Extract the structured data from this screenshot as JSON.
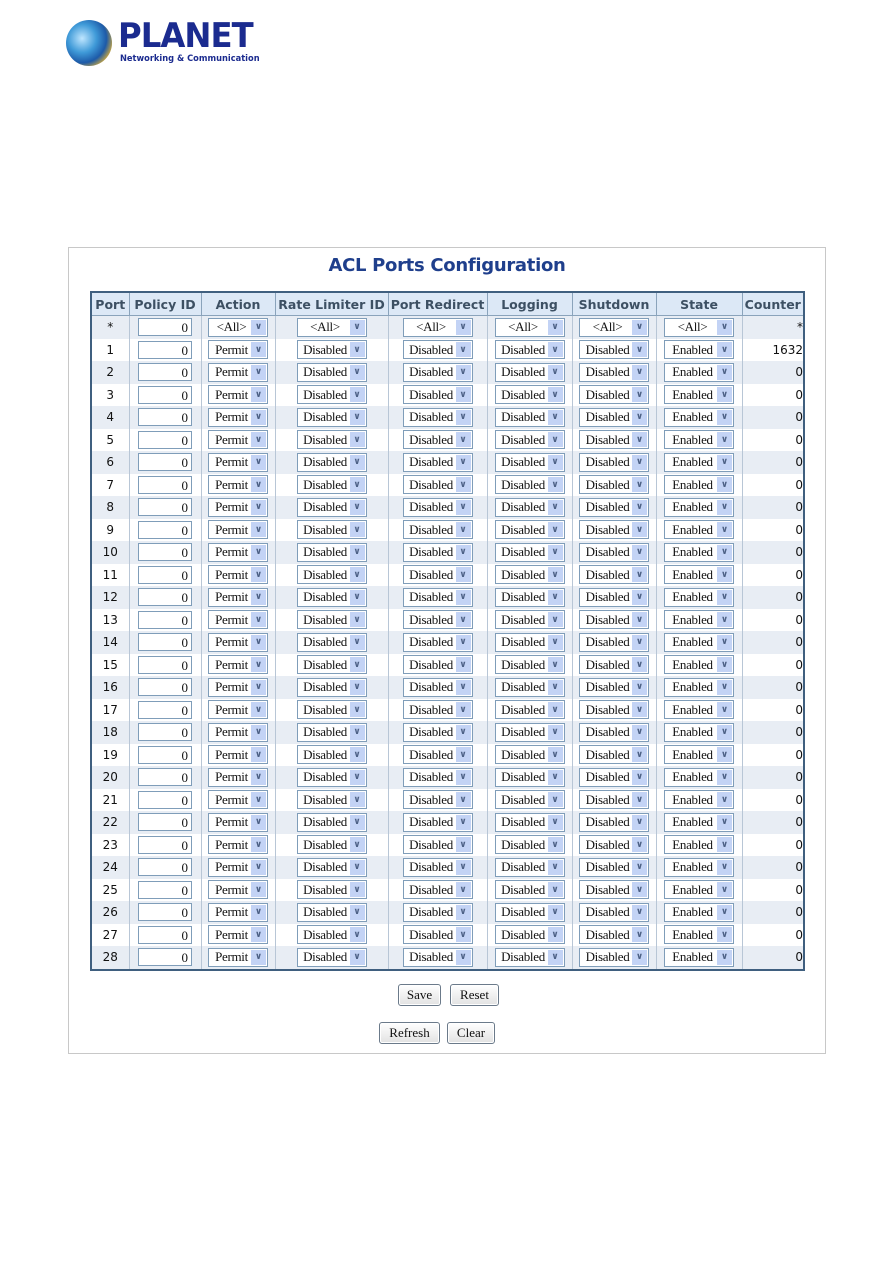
{
  "brand": {
    "name": "PLANET",
    "tagline": "Networking & Communication"
  },
  "page": {
    "title": "ACL Ports Configuration"
  },
  "colors": {
    "title": "#1f3f8c",
    "header_bg": "#dce8f6",
    "table_border": "#3f5f7f",
    "row_alt": "#e8edf4"
  },
  "table": {
    "headers": [
      "Port",
      "Policy ID",
      "Action",
      "Rate Limiter ID",
      "Port Redirect",
      "Logging",
      "Shutdown",
      "State",
      "Counter"
    ],
    "global_row": {
      "port": "*",
      "policy_id": "0",
      "action": "<All>",
      "rate_limiter_id": "<All>",
      "port_redirect": "<All>",
      "logging": "<All>",
      "shutdown": "<All>",
      "state": "<All>",
      "counter": "*"
    },
    "rows": [
      {
        "port": "1",
        "policy_id": "0",
        "action": "Permit",
        "rate_limiter_id": "Disabled",
        "port_redirect": "Disabled",
        "logging": "Disabled",
        "shutdown": "Disabled",
        "state": "Enabled",
        "counter": "1632"
      },
      {
        "port": "2",
        "policy_id": "0",
        "action": "Permit",
        "rate_limiter_id": "Disabled",
        "port_redirect": "Disabled",
        "logging": "Disabled",
        "shutdown": "Disabled",
        "state": "Enabled",
        "counter": "0"
      },
      {
        "port": "3",
        "policy_id": "0",
        "action": "Permit",
        "rate_limiter_id": "Disabled",
        "port_redirect": "Disabled",
        "logging": "Disabled",
        "shutdown": "Disabled",
        "state": "Enabled",
        "counter": "0"
      },
      {
        "port": "4",
        "policy_id": "0",
        "action": "Permit",
        "rate_limiter_id": "Disabled",
        "port_redirect": "Disabled",
        "logging": "Disabled",
        "shutdown": "Disabled",
        "state": "Enabled",
        "counter": "0"
      },
      {
        "port": "5",
        "policy_id": "0",
        "action": "Permit",
        "rate_limiter_id": "Disabled",
        "port_redirect": "Disabled",
        "logging": "Disabled",
        "shutdown": "Disabled",
        "state": "Enabled",
        "counter": "0"
      },
      {
        "port": "6",
        "policy_id": "0",
        "action": "Permit",
        "rate_limiter_id": "Disabled",
        "port_redirect": "Disabled",
        "logging": "Disabled",
        "shutdown": "Disabled",
        "state": "Enabled",
        "counter": "0"
      },
      {
        "port": "7",
        "policy_id": "0",
        "action": "Permit",
        "rate_limiter_id": "Disabled",
        "port_redirect": "Disabled",
        "logging": "Disabled",
        "shutdown": "Disabled",
        "state": "Enabled",
        "counter": "0"
      },
      {
        "port": "8",
        "policy_id": "0",
        "action": "Permit",
        "rate_limiter_id": "Disabled",
        "port_redirect": "Disabled",
        "logging": "Disabled",
        "shutdown": "Disabled",
        "state": "Enabled",
        "counter": "0"
      },
      {
        "port": "9",
        "policy_id": "0",
        "action": "Permit",
        "rate_limiter_id": "Disabled",
        "port_redirect": "Disabled",
        "logging": "Disabled",
        "shutdown": "Disabled",
        "state": "Enabled",
        "counter": "0"
      },
      {
        "port": "10",
        "policy_id": "0",
        "action": "Permit",
        "rate_limiter_id": "Disabled",
        "port_redirect": "Disabled",
        "logging": "Disabled",
        "shutdown": "Disabled",
        "state": "Enabled",
        "counter": "0"
      },
      {
        "port": "11",
        "policy_id": "0",
        "action": "Permit",
        "rate_limiter_id": "Disabled",
        "port_redirect": "Disabled",
        "logging": "Disabled",
        "shutdown": "Disabled",
        "state": "Enabled",
        "counter": "0"
      },
      {
        "port": "12",
        "policy_id": "0",
        "action": "Permit",
        "rate_limiter_id": "Disabled",
        "port_redirect": "Disabled",
        "logging": "Disabled",
        "shutdown": "Disabled",
        "state": "Enabled",
        "counter": "0"
      },
      {
        "port": "13",
        "policy_id": "0",
        "action": "Permit",
        "rate_limiter_id": "Disabled",
        "port_redirect": "Disabled",
        "logging": "Disabled",
        "shutdown": "Disabled",
        "state": "Enabled",
        "counter": "0"
      },
      {
        "port": "14",
        "policy_id": "0",
        "action": "Permit",
        "rate_limiter_id": "Disabled",
        "port_redirect": "Disabled",
        "logging": "Disabled",
        "shutdown": "Disabled",
        "state": "Enabled",
        "counter": "0"
      },
      {
        "port": "15",
        "policy_id": "0",
        "action": "Permit",
        "rate_limiter_id": "Disabled",
        "port_redirect": "Disabled",
        "logging": "Disabled",
        "shutdown": "Disabled",
        "state": "Enabled",
        "counter": "0"
      },
      {
        "port": "16",
        "policy_id": "0",
        "action": "Permit",
        "rate_limiter_id": "Disabled",
        "port_redirect": "Disabled",
        "logging": "Disabled",
        "shutdown": "Disabled",
        "state": "Enabled",
        "counter": "0"
      },
      {
        "port": "17",
        "policy_id": "0",
        "action": "Permit",
        "rate_limiter_id": "Disabled",
        "port_redirect": "Disabled",
        "logging": "Disabled",
        "shutdown": "Disabled",
        "state": "Enabled",
        "counter": "0"
      },
      {
        "port": "18",
        "policy_id": "0",
        "action": "Permit",
        "rate_limiter_id": "Disabled",
        "port_redirect": "Disabled",
        "logging": "Disabled",
        "shutdown": "Disabled",
        "state": "Enabled",
        "counter": "0"
      },
      {
        "port": "19",
        "policy_id": "0",
        "action": "Permit",
        "rate_limiter_id": "Disabled",
        "port_redirect": "Disabled",
        "logging": "Disabled",
        "shutdown": "Disabled",
        "state": "Enabled",
        "counter": "0"
      },
      {
        "port": "20",
        "policy_id": "0",
        "action": "Permit",
        "rate_limiter_id": "Disabled",
        "port_redirect": "Disabled",
        "logging": "Disabled",
        "shutdown": "Disabled",
        "state": "Enabled",
        "counter": "0"
      },
      {
        "port": "21",
        "policy_id": "0",
        "action": "Permit",
        "rate_limiter_id": "Disabled",
        "port_redirect": "Disabled",
        "logging": "Disabled",
        "shutdown": "Disabled",
        "state": "Enabled",
        "counter": "0"
      },
      {
        "port": "22",
        "policy_id": "0",
        "action": "Permit",
        "rate_limiter_id": "Disabled",
        "port_redirect": "Disabled",
        "logging": "Disabled",
        "shutdown": "Disabled",
        "state": "Enabled",
        "counter": "0"
      },
      {
        "port": "23",
        "policy_id": "0",
        "action": "Permit",
        "rate_limiter_id": "Disabled",
        "port_redirect": "Disabled",
        "logging": "Disabled",
        "shutdown": "Disabled",
        "state": "Enabled",
        "counter": "0"
      },
      {
        "port": "24",
        "policy_id": "0",
        "action": "Permit",
        "rate_limiter_id": "Disabled",
        "port_redirect": "Disabled",
        "logging": "Disabled",
        "shutdown": "Disabled",
        "state": "Enabled",
        "counter": "0"
      },
      {
        "port": "25",
        "policy_id": "0",
        "action": "Permit",
        "rate_limiter_id": "Disabled",
        "port_redirect": "Disabled",
        "logging": "Disabled",
        "shutdown": "Disabled",
        "state": "Enabled",
        "counter": "0"
      },
      {
        "port": "26",
        "policy_id": "0",
        "action": "Permit",
        "rate_limiter_id": "Disabled",
        "port_redirect": "Disabled",
        "logging": "Disabled",
        "shutdown": "Disabled",
        "state": "Enabled",
        "counter": "0"
      },
      {
        "port": "27",
        "policy_id": "0",
        "action": "Permit",
        "rate_limiter_id": "Disabled",
        "port_redirect": "Disabled",
        "logging": "Disabled",
        "shutdown": "Disabled",
        "state": "Enabled",
        "counter": "0"
      },
      {
        "port": "28",
        "policy_id": "0",
        "action": "Permit",
        "rate_limiter_id": "Disabled",
        "port_redirect": "Disabled",
        "logging": "Disabled",
        "shutdown": "Disabled",
        "state": "Enabled",
        "counter": "0"
      }
    ]
  },
  "buttons": {
    "save": "Save",
    "reset": "Reset",
    "refresh": "Refresh",
    "clear": "Clear"
  },
  "icons": {
    "dropdown": "chevron-down-icon"
  }
}
